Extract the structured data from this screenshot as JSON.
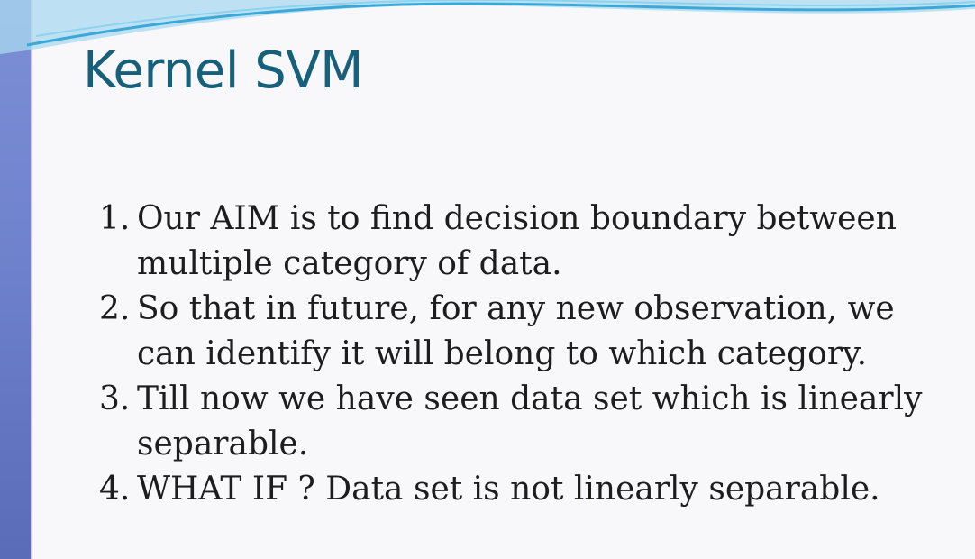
{
  "slide": {
    "title": "Kernel SVM",
    "points": [
      {
        "number": "1.",
        "text": "Our AIM is to find decision boundary between multiple category of data."
      },
      {
        "number": "2.",
        "text": "So that in future, for any new observation, we can identify it will belong to which category."
      },
      {
        "number": "3.",
        "text": "Till now we have seen data set which is linearly separable."
      },
      {
        "number": "4.",
        "text": "WHAT IF ? Data set is not linearly separable."
      }
    ]
  },
  "theme": {
    "title_color": "#17607c",
    "accent_bar_color": "#6f82cc",
    "wave_color": "#5fb8e0",
    "background": "#f8f8fa",
    "text_color": "#1d1d1d"
  }
}
